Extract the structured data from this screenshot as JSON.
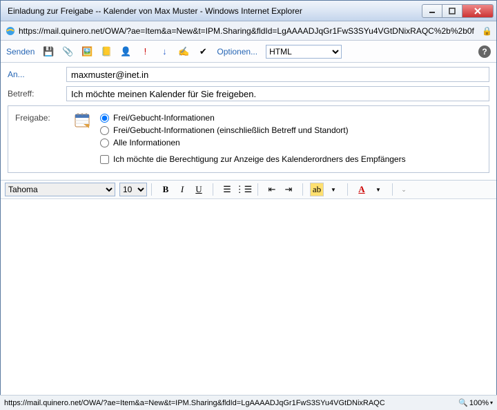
{
  "window": {
    "title": "Einladung zur Freigabe -- Kalender von Max Muster - Windows Internet Explorer",
    "url": "https://mail.quinero.net/OWA/?ae=Item&a=New&t=IPM.Sharing&fldId=LgAAAADJqGr1FwS3SYu4VGtDNixRAQC%2b%2b0f"
  },
  "toolbar": {
    "send": "Senden",
    "options": "Optionen...",
    "format_value": "HTML"
  },
  "fields": {
    "to_label": "An...",
    "to_value": "maxmuster@inet.in",
    "subject_label": "Betreff:",
    "subject_value": "Ich möchte meinen Kalender für Sie freigeben."
  },
  "share": {
    "label": "Freigabe:",
    "opt1": "Frei/Gebucht-Informationen",
    "opt2": "Frei/Gebucht-Informationen (einschließlich Betreff und Standort)",
    "opt3": "Alle Informationen",
    "chk": "Ich möchte die Berechtigung zur Anzeige des Kalenderordners des Empfängers"
  },
  "editor": {
    "font_name": "Tahoma",
    "font_size": "10"
  },
  "status": {
    "url": "https://mail.quinero.net/OWA/?ae=Item&a=New&t=IPM.Sharing&fldId=LgAAAADJqGr1FwS3SYu4VGtDNixRAQC",
    "zoom": "100%"
  }
}
